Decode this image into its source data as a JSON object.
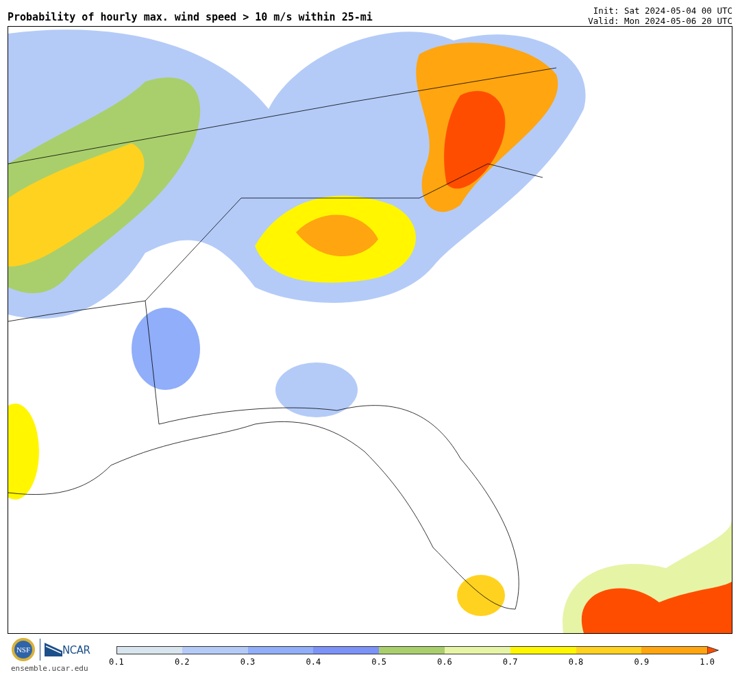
{
  "header": {
    "title": "Probability of hourly max. wind speed > 10 m/s within 25-mi",
    "init": "Init: Sat 2024-05-04 00 UTC",
    "valid": "Valid: Mon 2024-05-06 20 UTC"
  },
  "footer": {
    "nsf_text": "NSF",
    "org": "NCAR",
    "url": "ensemble.ucar.edu"
  },
  "colorbar": {
    "bins": [
      {
        "kind": "segment",
        "color": "#d8e4ee"
      },
      {
        "kind": "segment",
        "color": "#b4cbf8"
      },
      {
        "kind": "segment",
        "color": "#90aef9"
      },
      {
        "kind": "segment",
        "color": "#7b92f9"
      },
      {
        "kind": "segment",
        "color": "#a9cf6c"
      },
      {
        "kind": "segment",
        "color": "#e6f4a6"
      },
      {
        "kind": "segment",
        "color": "#fff600"
      },
      {
        "kind": "segment",
        "color": "#ffd21f"
      },
      {
        "kind": "segment",
        "color": "#ffa510"
      },
      {
        "kind": "arrow",
        "color": "#ff4d00"
      }
    ],
    "ticks": [
      "0.1",
      "0.2",
      "0.3",
      "0.4",
      "0.5",
      "0.6",
      "0.7",
      "0.8",
      "0.9",
      "1.0"
    ]
  }
}
